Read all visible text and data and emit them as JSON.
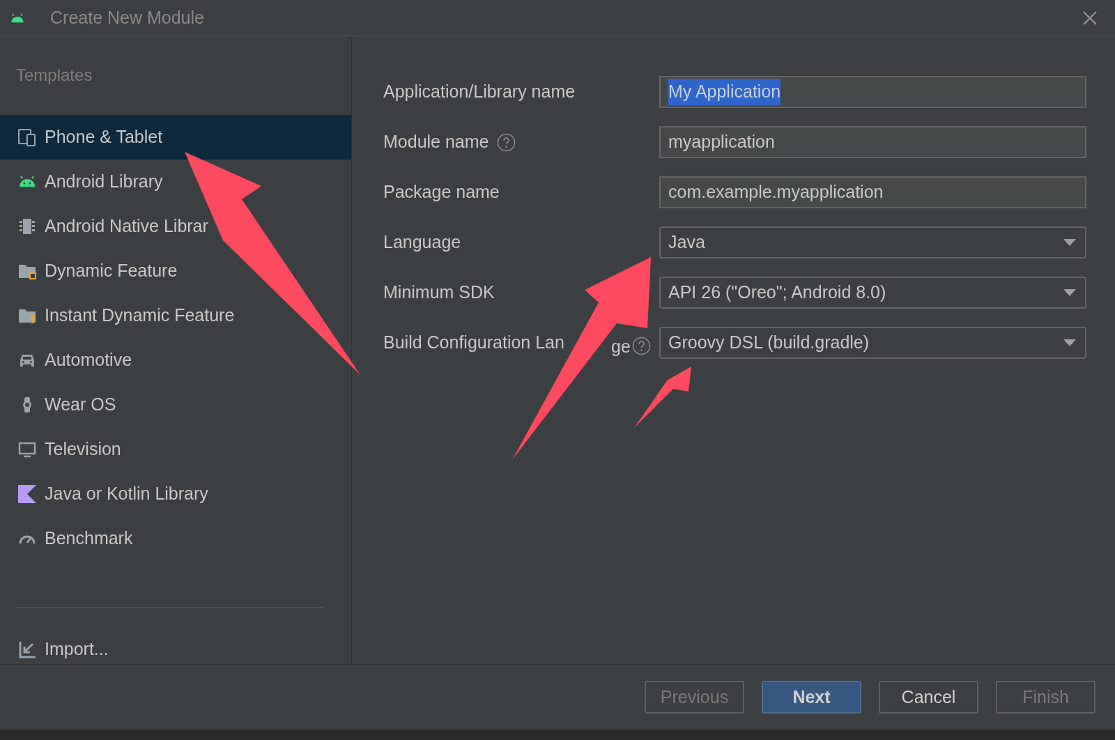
{
  "window": {
    "title": "Create New Module"
  },
  "sidebar": {
    "heading": "Templates",
    "items": [
      {
        "label": "Phone & Tablet",
        "selected": true
      },
      {
        "label": "Android Library",
        "selected": false
      },
      {
        "label": "Android Native Librar",
        "selected": false
      },
      {
        "label": "Dynamic Feature",
        "selected": false
      },
      {
        "label": "Instant Dynamic Feature",
        "selected": false
      },
      {
        "label": "Automotive",
        "selected": false
      },
      {
        "label": "Wear OS",
        "selected": false
      },
      {
        "label": "Television",
        "selected": false
      },
      {
        "label": "Java or Kotlin Library",
        "selected": false
      },
      {
        "label": "Benchmark",
        "selected": false
      }
    ],
    "import": "Import..."
  },
  "form": [
    {
      "label": "Application/Library name",
      "kind": "text",
      "value": "My Application",
      "text_selected": true,
      "help": false
    },
    {
      "label": "Module name",
      "kind": "text",
      "value": "myapplication",
      "text_selected": false,
      "help": true
    },
    {
      "label": "Package name",
      "kind": "text",
      "value": "com.example.myapplication",
      "text_selected": false,
      "help": false
    },
    {
      "label": "Language",
      "kind": "dropdown",
      "value": "Java",
      "help": false
    },
    {
      "label": "Minimum SDK",
      "kind": "dropdown",
      "value": "API 26 (\"Oreo\"; Android 8.0)",
      "help": false
    },
    {
      "label": "Build Configuration Lan",
      "label_end": "ge",
      "kind": "dropdown",
      "value": "Groovy DSL (build.gradle)",
      "help": true
    }
  ],
  "buttons": [
    {
      "label": "Previous",
      "disabled": true,
      "default": false
    },
    {
      "label": "Next",
      "disabled": false,
      "default": true
    },
    {
      "label": "Cancel",
      "disabled": false,
      "default": false
    },
    {
      "label": "Finish",
      "disabled": true,
      "default": false
    }
  ]
}
